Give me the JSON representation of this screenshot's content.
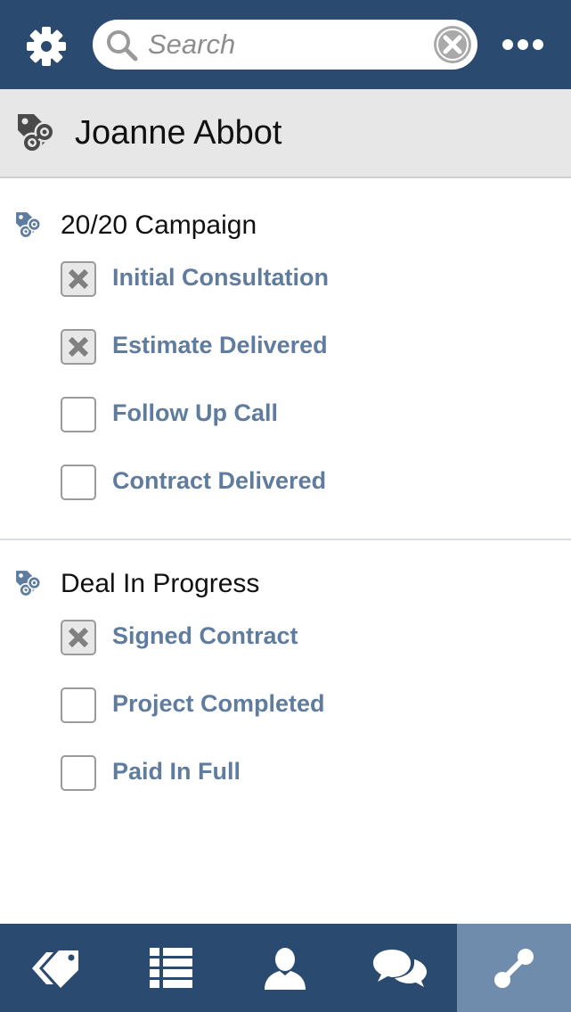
{
  "search": {
    "placeholder": "Search"
  },
  "header": {
    "title": "Joanne Abbot"
  },
  "groups": [
    {
      "title": "20/20 Campaign",
      "tasks": [
        {
          "label": "Initial Consultation",
          "checked": true
        },
        {
          "label": "Estimate Delivered",
          "checked": true
        },
        {
          "label": "Follow Up Call",
          "checked": false
        },
        {
          "label": "Contract Delivered",
          "checked": false
        }
      ]
    },
    {
      "title": "Deal In Progress",
      "tasks": [
        {
          "label": "Signed Contract",
          "checked": true
        },
        {
          "label": "Project Completed",
          "checked": false
        },
        {
          "label": "Paid In Full",
          "checked": false
        }
      ]
    }
  ],
  "bottom_nav": [
    {
      "icon": "tags-icon",
      "active": false
    },
    {
      "icon": "list-icon",
      "active": false
    },
    {
      "icon": "contact-icon",
      "active": false
    },
    {
      "icon": "chat-icon",
      "active": false
    },
    {
      "icon": "link-icon",
      "active": true
    }
  ],
  "colors": {
    "topbar": "#2b4a70",
    "active_tab": "#6f8cad",
    "task_label": "#5f7c9e",
    "header_bg": "#e7e7e7"
  }
}
